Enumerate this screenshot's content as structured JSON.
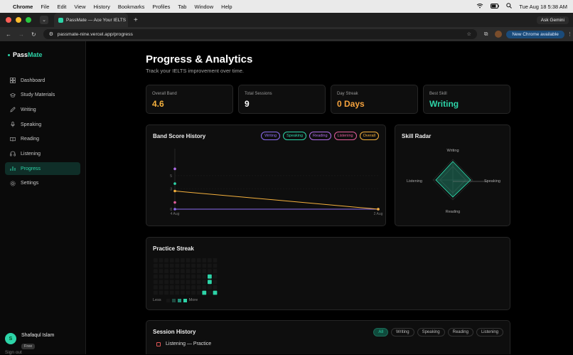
{
  "os_menu": {
    "apple": "",
    "items": [
      "Chrome",
      "File",
      "Edit",
      "View",
      "History",
      "Bookmarks",
      "Profiles",
      "Tab",
      "Window",
      "Help"
    ],
    "clock": "Tue Aug 18  5:38 AM"
  },
  "browser": {
    "tab_title": "PassMate — Ace Your IELTS",
    "tab_close": "×",
    "new_tab": "+",
    "ask_gemini": "Ask Gemini",
    "url": "passmate-nine.vercel.app/progress",
    "new_chrome": "New Chrome available",
    "menu_dots": "⋮"
  },
  "sidebar": {
    "logo_pass": "Pass",
    "logo_mate": "Mate",
    "items": [
      {
        "label": "Dashboard",
        "icon": "grid-icon"
      },
      {
        "label": "Study Materials",
        "icon": "graduation-cap-icon"
      },
      {
        "label": "Writing",
        "icon": "pen-icon"
      },
      {
        "label": "Speaking",
        "icon": "microphone-icon"
      },
      {
        "label": "Reading",
        "icon": "book-icon"
      },
      {
        "label": "Listening",
        "icon": "headphones-icon"
      },
      {
        "label": "Progress",
        "icon": "bar-chart-icon",
        "active": true
      },
      {
        "label": "Settings",
        "icon": "gear-icon"
      }
    ],
    "user": {
      "initial": "S",
      "name": "Shafaqul Islam",
      "plan": "Free"
    },
    "signout": "Sign out"
  },
  "page": {
    "title": "Progress & Analytics",
    "subtitle": "Track your IELTS improvement over time."
  },
  "stats": [
    {
      "label": "Overall Band",
      "value": "4.6",
      "color": "#f5b13d"
    },
    {
      "label": "Total Sessions",
      "value": "9",
      "color": "#ffffff"
    },
    {
      "label": "Day Streak",
      "value": "0 Days",
      "color": "#f5a23d"
    },
    {
      "label": "Best Skill",
      "value": "Writing",
      "color": "#2dd4a8"
    }
  ],
  "band_history": {
    "title": "Band Score History",
    "legend": [
      {
        "name": "Writing",
        "color": "#8b6cf0"
      },
      {
        "name": "Speaking",
        "color": "#2dd4a8"
      },
      {
        "name": "Reading",
        "color": "#b06ce8"
      },
      {
        "name": "Listening",
        "color": "#e25c9a"
      },
      {
        "name": "Overall",
        "color": "#f5b13d"
      }
    ]
  },
  "chart_data": {
    "type": "line",
    "title": "Band Score History",
    "x": [
      "4 Aug",
      "2 Aug"
    ],
    "ylim": [
      0,
      9
    ],
    "y_ticks": [
      5,
      3,
      0
    ],
    "series": [
      {
        "name": "Writing",
        "color": "#8b6cf0",
        "values": [
          0,
          0
        ]
      },
      {
        "name": "Speaking",
        "color": "#2dd4a8",
        "values": [
          3.8,
          null
        ]
      },
      {
        "name": "Reading",
        "color": "#b06ce8",
        "values": [
          6,
          null
        ]
      },
      {
        "name": "Listening",
        "color": "#e25c9a",
        "values": [
          1,
          null
        ]
      },
      {
        "name": "Overall",
        "color": "#f5b13d",
        "values": [
          2.7,
          0
        ]
      }
    ],
    "grid": true
  },
  "skill_radar": {
    "title": "Skill Radar",
    "labels": {
      "top": "Writing",
      "right": "Speaking",
      "bottom": "Reading",
      "left": "Listening"
    }
  },
  "practice_streak": {
    "title": "Practice Streak",
    "less": "Less",
    "more": "More",
    "active_cells": [
      [
        10,
        3
      ],
      [
        10,
        4
      ],
      [
        9,
        6
      ],
      [
        11,
        6
      ]
    ]
  },
  "session_history": {
    "title": "Session History",
    "filters": [
      {
        "label": "All",
        "active": true
      },
      {
        "label": "Writing"
      },
      {
        "label": "Speaking"
      },
      {
        "label": "Reading"
      },
      {
        "label": "Listening"
      }
    ],
    "first_item": "Listening — Practice"
  }
}
